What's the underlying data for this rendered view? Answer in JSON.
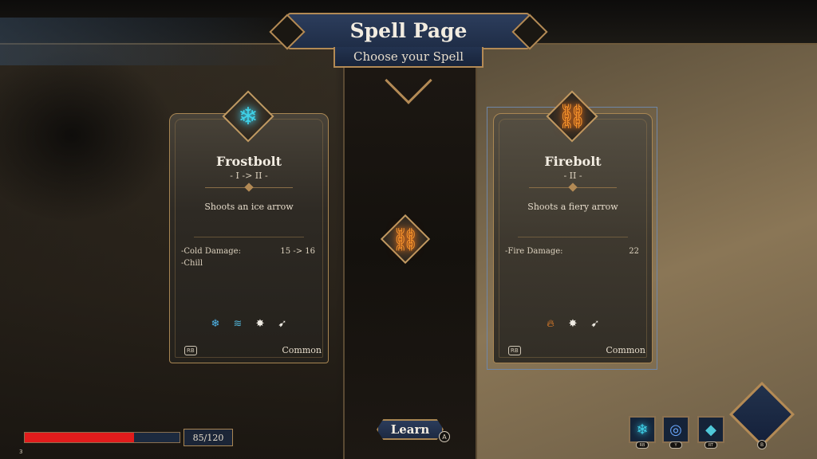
{
  "header": {
    "title": "Spell Page",
    "subtitle": "Choose your Spell"
  },
  "cards": [
    {
      "name": "Frostbolt",
      "rank": "- I -> II -",
      "description": "Shoots an ice arrow",
      "stats": [
        {
          "label": "-Cold Damage:",
          "value": "15 -> 16"
        },
        {
          "label": "-Chill",
          "value": ""
        }
      ],
      "tags": [
        "snowflake",
        "wind",
        "impact",
        "projectile"
      ],
      "button_badge": "RB",
      "rarity": "Common",
      "icon": "frost-wing-icon",
      "accent": "#3fd2e8"
    },
    {
      "name": "Firebolt",
      "rank": "- II -",
      "description": "Shoots a fiery arrow",
      "stats": [
        {
          "label": "-Fire Damage:",
          "value": "22"
        }
      ],
      "tags": [
        "fire",
        "impact",
        "projectile"
      ],
      "button_badge": "RB",
      "rarity": "Common",
      "icon": "fire-chain-icon",
      "accent": "#ff9a2e"
    }
  ],
  "learn_button": {
    "label": "Learn",
    "badge": "A"
  },
  "player": {
    "hp_current": 85,
    "hp_max": 120,
    "hp_text": "85/120",
    "level": "3"
  },
  "abilities": [
    {
      "icon": "frost-wing-icon",
      "badge": "RB"
    },
    {
      "icon": "vortex-icon",
      "badge": "Y"
    },
    {
      "icon": "crystal-icon",
      "badge": "RT"
    }
  ],
  "main_slot_badge": "B",
  "colors": {
    "hp_red": "#e11c1c",
    "gold_trim": "#b38a55",
    "banner_blue": "#2c3d5c"
  }
}
